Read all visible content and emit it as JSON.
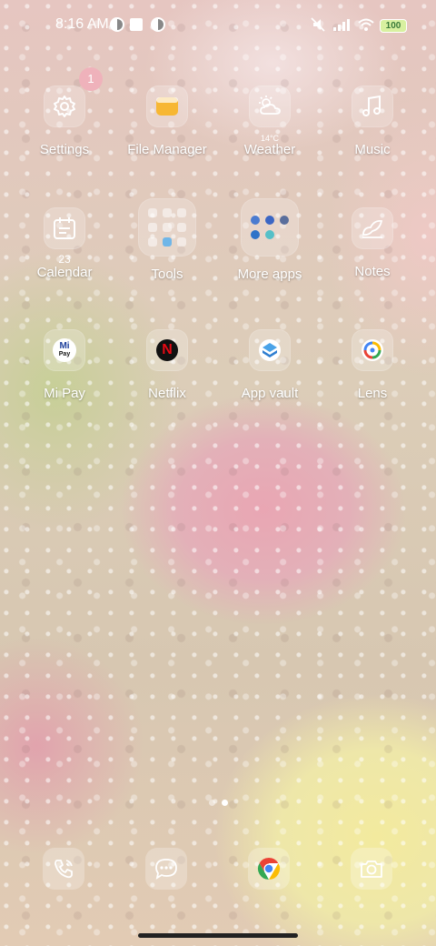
{
  "status_bar": {
    "time": "8:16 AM",
    "battery_level": "100"
  },
  "apps": [
    {
      "label": "Settings",
      "icon": "gear-icon",
      "badge": "1"
    },
    {
      "label": "File Manager",
      "icon": "folder-icon"
    },
    {
      "label": "Weather",
      "icon": "weather-cloud-sun-icon",
      "detail": "14°C"
    },
    {
      "label": "Music",
      "icon": "music-note-icon"
    },
    {
      "label": "Calendar",
      "icon": "calendar-icon",
      "detail": "23"
    },
    {
      "label": "Tools",
      "icon": "tools-folder-icon"
    },
    {
      "label": "More apps",
      "icon": "more-apps-folder-icon"
    },
    {
      "label": "Notes",
      "icon": "notes-icon"
    },
    {
      "label": "Mi Pay",
      "icon": "mi-pay-icon",
      "icon_text": "Mi",
      "icon_subtext": "Pay"
    },
    {
      "label": "Netflix",
      "icon": "netflix-icon",
      "icon_text": "N"
    },
    {
      "label": "App vault",
      "icon": "app-vault-icon"
    },
    {
      "label": "Lens",
      "icon": "lens-icon"
    }
  ],
  "pagination": {
    "pages": 2,
    "current": 2
  },
  "dock": [
    {
      "icon": "phone-icon"
    },
    {
      "icon": "messages-icon"
    },
    {
      "icon": "chrome-icon"
    },
    {
      "icon": "camera-icon"
    }
  ],
  "colors": {
    "badge": "#efb2bb",
    "netflix_red": "#e50914",
    "file_manager_yellow": "#f7b733",
    "battery_fill": "#d8f0a0"
  }
}
